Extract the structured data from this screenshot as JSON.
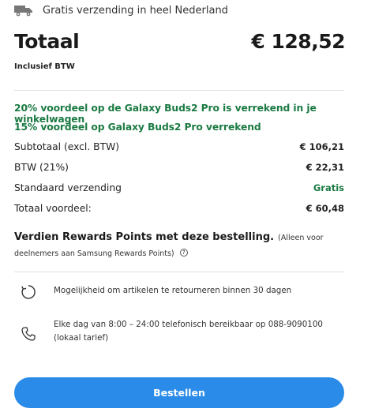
{
  "shipping": {
    "icon": "truck-icon",
    "text": "Gratis verzending in heel Nederland"
  },
  "total": {
    "label": "Totaal",
    "value": "€ 128,52",
    "vat_note": "Inclusief BTW"
  },
  "promotions": [
    "20% voordeel op de Galaxy Buds2 Pro is verrekend in je winkelwagen",
    "15% voordeel op Galaxy Buds2 Pro verrekend"
  ],
  "summary": [
    {
      "label": "Subtotaal (excl. BTW)",
      "value": "€ 106,21"
    },
    {
      "label": "BTW (21%)",
      "value": "€ 22,31"
    },
    {
      "label": "Standaard verzending",
      "value": "Gratis"
    },
    {
      "label": "Totaal voordeel:",
      "value": "€ 60,48"
    }
  ],
  "rewards": {
    "title": "Verdien Rewards Points met deze bestelling.",
    "note": "(Alleen voor deelnemers aan Samsung Rewards Points)"
  },
  "features": [
    {
      "icon": "return-icon",
      "text": "Mogelijkheid om artikelen te retourneren binnen 30 dagen"
    },
    {
      "icon": "phone-icon",
      "text": "Elke dag van 8:00 – 24:00 telefonisch bereikbaar op 088-9090100 (lokaal tarief)"
    }
  ],
  "checkout_button": "Bestellen",
  "colors": {
    "accent": "#2a8be8",
    "promo_green": "#1b7a43"
  }
}
